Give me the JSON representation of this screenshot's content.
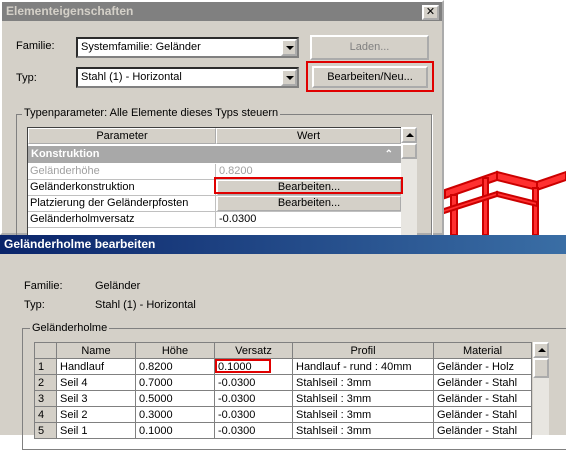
{
  "dialog1": {
    "title": "Elementeigenschaften",
    "close_glyph": "✕",
    "familie_label": "Familie:",
    "familie_value": "Systemfamilie: Geländer",
    "typ_label": "Typ:",
    "typ_value": "Stahl (1) - Horizontal",
    "laden_label": "Laden...",
    "bearbeiten_neu_label": "Bearbeiten/Neu...",
    "group_label": "Typenparameter: Alle Elemente dieses Typs steuern",
    "col_parameter": "Parameter",
    "col_wert": "Wert",
    "section": "Konstruktion",
    "rows": [
      {
        "param": "Geländerhöhe",
        "value": "0.8200",
        "disabled": true
      },
      {
        "param": "Geländerkonstruktion",
        "value": "Bearbeiten...",
        "button": true
      },
      {
        "param": "Platzierung der Geländerpfosten",
        "value": "Bearbeiten...",
        "button": true
      },
      {
        "param": "Geländerholmversatz",
        "value": "-0.0300"
      }
    ]
  },
  "dialog2": {
    "title": "Geländerholme bearbeiten",
    "familie_label": "Familie:",
    "familie_value": "Geländer",
    "typ_label": "Typ:",
    "typ_value": "Stahl (1) - Horizontal",
    "group_label": "Geländerholme",
    "columns": [
      "",
      "Name",
      "Höhe",
      "Versatz",
      "Profil",
      "Material"
    ],
    "rows": [
      [
        "1",
        "Handlauf",
        "0.8200",
        "0.1000",
        "Handlauf - rund : 40mm",
        "Geländer - Holz"
      ],
      [
        "2",
        "Seil 4",
        "0.7000",
        "-0.0300",
        "Stahlseil : 3mm",
        "Geländer - Stahl"
      ],
      [
        "3",
        "Seil 3",
        "0.5000",
        "-0.0300",
        "Stahlseil : 3mm",
        "Geländer - Stahl"
      ],
      [
        "4",
        "Seil 2",
        "0.3000",
        "-0.0300",
        "Stahlseil : 3mm",
        "Geländer - Stahl"
      ],
      [
        "5",
        "Seil 1",
        "0.1000",
        "-0.0300",
        "Stahlseil : 3mm",
        "Geländer - Stahl"
      ]
    ]
  },
  "colors": {
    "title_inactive": "#808080",
    "title_active": "#0a246a",
    "highlight": "#e00000",
    "railing": "#e00000"
  }
}
